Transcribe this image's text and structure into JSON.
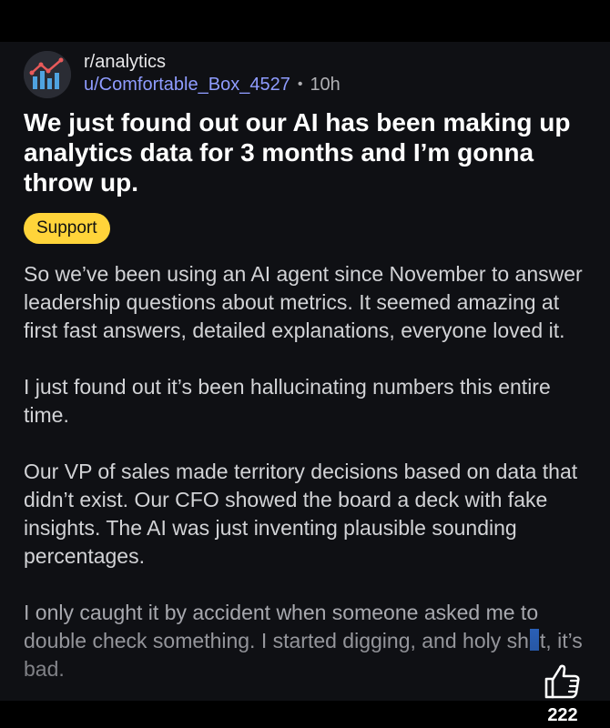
{
  "post": {
    "subreddit": "r/analytics",
    "username": "u/Comfortable_Box_4527",
    "separator": "•",
    "time_ago": "10h",
    "title": "We just found out our AI has been making up analytics data for 3 months and I’m gonna throw up.",
    "flair": "Support",
    "body": [
      "So we’ve been using an AI agent since November to answer leadership questions about metrics. It seemed amazing at first fast answers, detailed explanations, everyone loved it.",
      "I just found out it’s been hallucinating numbers this entire time.",
      "Our VP of sales made territory decisions based on data that didn’t exist. Our CFO showed the board a deck with fake insights. The AI was just inventing plausible sounding percentages."
    ],
    "last_paragraph": {
      "before": "I only caught it by accident when someone asked me to double check something. I started digging, and holy sh",
      "after": "t, it’s bad."
    }
  },
  "overlay": {
    "like_icon": "thumbs-up-icon",
    "like_count": "222"
  },
  "colors": {
    "background": "#0f1014",
    "username": "#8f9cff",
    "flair": "#ffd43a",
    "censor": "#2f6fd6"
  }
}
